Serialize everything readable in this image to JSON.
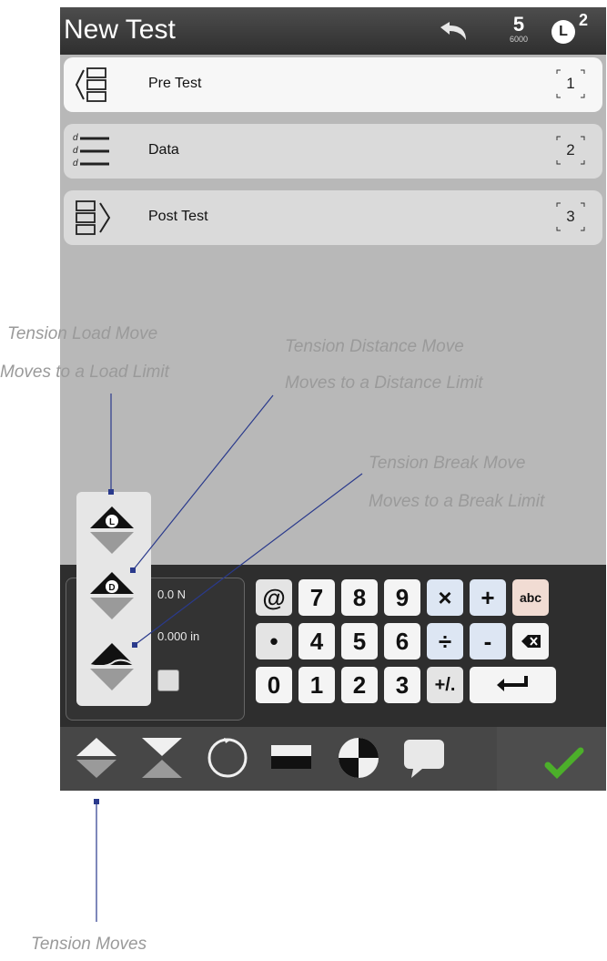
{
  "header": {
    "title": "New Test",
    "stage_number": "5",
    "stage_sub": "6000",
    "user_letter": "L",
    "user_superscript": "2"
  },
  "test_steps": [
    {
      "label": "Pre Test",
      "number": "1",
      "icon": "pre-test-icon"
    },
    {
      "label": "Data",
      "number": "2",
      "icon": "data-icon"
    },
    {
      "label": "Post Test",
      "number": "3",
      "icon": "post-test-icon"
    }
  ],
  "readout": {
    "load": "0.0 N",
    "distance": "0.000 in"
  },
  "keypad": {
    "row1": [
      "@",
      "7",
      "8",
      "9",
      "×",
      "+",
      "abc"
    ],
    "row2": [
      "•",
      "4",
      "5",
      "6",
      "÷",
      "-",
      "backspace-icon"
    ],
    "row3": [
      "0",
      "1",
      "2",
      "3",
      "+/.",
      "enter-icon"
    ]
  },
  "move_popup": {
    "load_letter": "L",
    "distance_letter": "D"
  },
  "bottom_icons": [
    "tension-move-icon",
    "compression-move-icon",
    "cycle-icon",
    "hold-icon",
    "target-icon",
    "comment-icon",
    "check-icon"
  ],
  "annotations": {
    "load_line1": "Tension Load Move",
    "load_line2": "Moves to a Load Limit",
    "distance_line1": "Tension Distance Move",
    "distance_line2": "Moves to a Distance Limit",
    "break_line1": "Tension Break Move",
    "break_line2": "Moves to a Break Limit",
    "tension_moves": "Tension Moves"
  },
  "colors": {
    "annotation_text": "#9a9a9a",
    "leader_line": "#2a3a8c",
    "check": "#4caf2a"
  }
}
